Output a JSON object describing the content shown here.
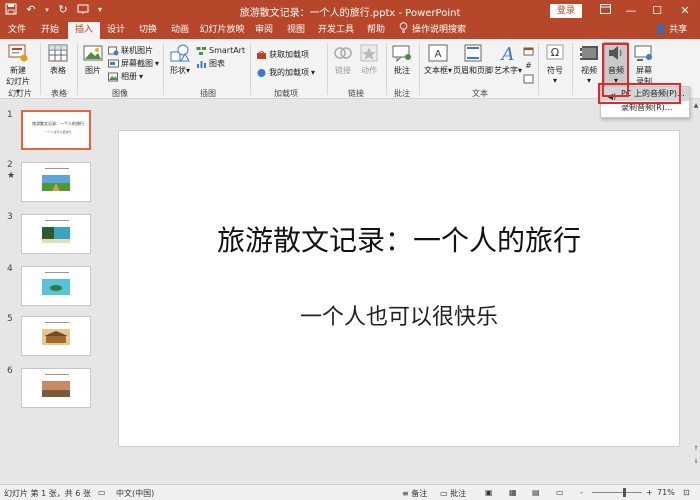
{
  "app": {
    "title": "旅游散文记录：一个人的旅行.pptx  -  PowerPoint",
    "login_label": "登录",
    "window_controls": [
      "restore-ribbon-icon",
      "minimize-icon",
      "maximize-icon",
      "close-icon"
    ],
    "accent_color": "#b7472a"
  },
  "tabs": [
    {
      "label": "文件",
      "active": false
    },
    {
      "label": "开始",
      "active": false
    },
    {
      "label": "插入",
      "active": true
    },
    {
      "label": "设计",
      "active": false
    },
    {
      "label": "切换",
      "active": false
    },
    {
      "label": "动画",
      "active": false
    },
    {
      "label": "幻灯片放映",
      "active": false
    },
    {
      "label": "审阅",
      "active": false
    },
    {
      "label": "视图",
      "active": false
    },
    {
      "label": "开发工具",
      "active": false
    },
    {
      "label": "帮助",
      "active": false
    }
  ],
  "tell_me": "操作说明搜索",
  "share_label": "共享",
  "ribbon": {
    "new_slide": "新建\n幻灯片",
    "table": "表格",
    "picture": "图片",
    "online_picture": "联机图片",
    "screenshot": "屏幕截图",
    "album": "相册",
    "shapes": "形状",
    "smartart": "SmartArt",
    "chart": "图表",
    "get_addins": "获取加载项",
    "my_addins": "我的加载项",
    "link": "链接",
    "action": "动作",
    "comment": "批注",
    "textbox": "文本框",
    "header_footer": "页眉和页脚",
    "wordart": "艺术字",
    "symbol": "符号",
    "video": "视频",
    "audio": "音频",
    "screen_record": "屏幕\n录制",
    "groups": {
      "slides": "幻灯片",
      "tables": "表格",
      "images": "图像",
      "illustrations": "插图",
      "addins": "加载项",
      "links": "链接",
      "comments": "批注",
      "text": "文本"
    }
  },
  "audio_menu": {
    "item1": "PC 上的音频(P)...",
    "item2": "录制音频(R)..."
  },
  "thumbnails": [
    {
      "num": "1",
      "star": "",
      "selected": true,
      "title": "旅游散文记录：一个人的旅行",
      "sub": "一个人也可以很快乐"
    },
    {
      "num": "2",
      "star": "★",
      "selected": false
    },
    {
      "num": "3",
      "star": "",
      "selected": false
    },
    {
      "num": "4",
      "star": "",
      "selected": false
    },
    {
      "num": "5",
      "star": "",
      "selected": false
    },
    {
      "num": "6",
      "star": "",
      "selected": false
    }
  ],
  "slide": {
    "title": "旅游散文记录：一个人的旅行",
    "subtitle": "一个人也可以很快乐"
  },
  "status": {
    "slide_info": "幻灯片 第 1 张，共 6 张",
    "language": "中文(中国)",
    "notes": "备注",
    "comments": "批注",
    "zoom_minus": "-",
    "zoom_plus": "+",
    "zoom": "71%",
    "zoom_fraction": 0.71
  }
}
